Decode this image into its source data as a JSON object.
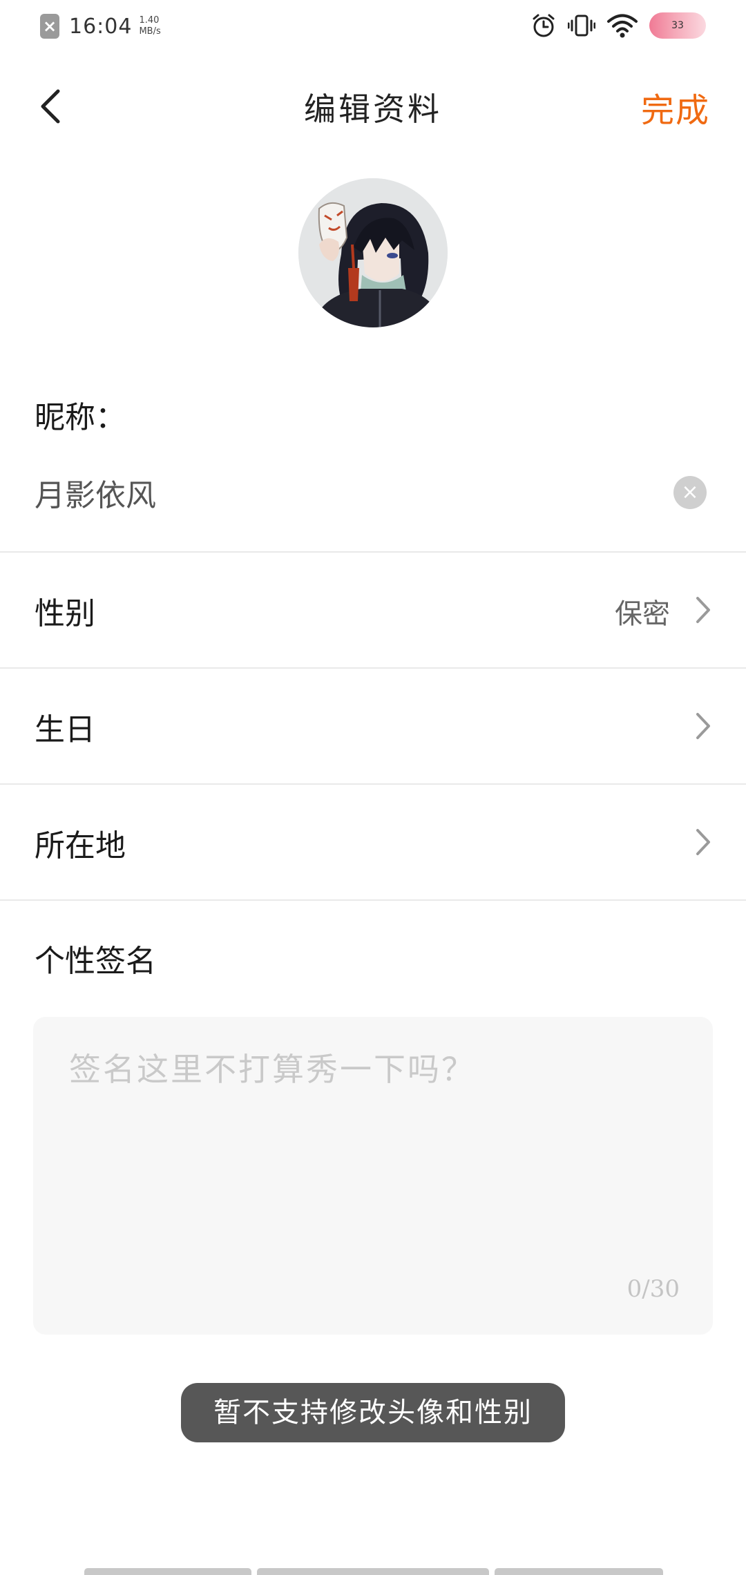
{
  "status_bar": {
    "time": "16:04",
    "speed_value": "1.40",
    "speed_unit": "MB/s",
    "battery_level": "33",
    "icons": [
      "notification-x-icon",
      "alarm-icon",
      "vibrate-icon",
      "wifi-icon",
      "battery-icon"
    ]
  },
  "header": {
    "title": "编辑资料",
    "done_label": "完成"
  },
  "profile": {
    "nickname_label": "昵称：",
    "nickname_value": "月影依风",
    "gender_label": "性别",
    "gender_value": "保密",
    "birthday_label": "生日",
    "birthday_value": "",
    "location_label": "所在地",
    "location_value": "",
    "signature_label": "个性签名",
    "signature_placeholder": "签名这里不打算秀一下吗？",
    "signature_count": "0/30"
  },
  "toast": {
    "message": "暂不支持修改头像和性别"
  },
  "colors": {
    "accent": "#f06a12",
    "divider": "#e9e9e9",
    "signature_bg": "#f7f7f7",
    "toast_bg": "#575757"
  }
}
